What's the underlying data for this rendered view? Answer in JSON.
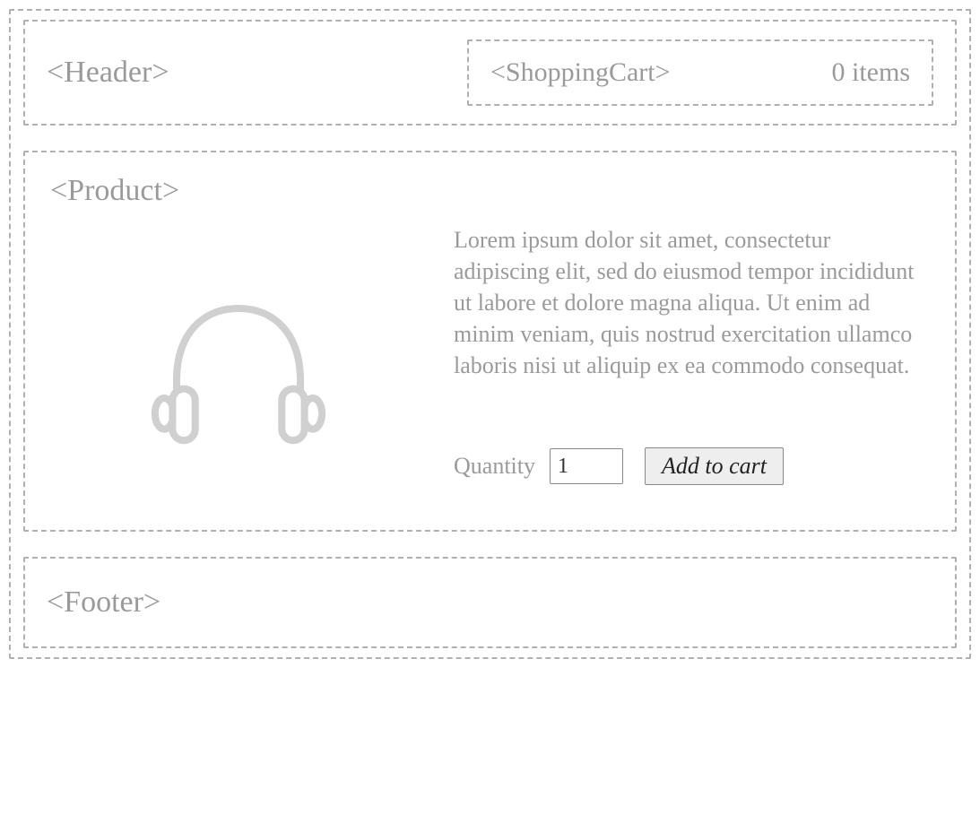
{
  "header": {
    "label": "<Header>"
  },
  "cart": {
    "label": "<ShoppingCart>",
    "count_text": "0 items"
  },
  "product": {
    "title": "<Product>",
    "description": "Lorem ipsum dolor sit amet, consectetur adipiscing elit, sed do eiusmod tempor incididunt ut labore et dolore magna aliqua. Ut enim ad minim veniam, quis nostrud exercitation ullamco laboris nisi ut aliquip ex ea commodo consequat.",
    "quantity_label": "Quantity",
    "quantity_value": "1",
    "add_button_label": "Add to cart",
    "image_icon": "headphones-icon"
  },
  "footer": {
    "label": "<Footer>"
  }
}
